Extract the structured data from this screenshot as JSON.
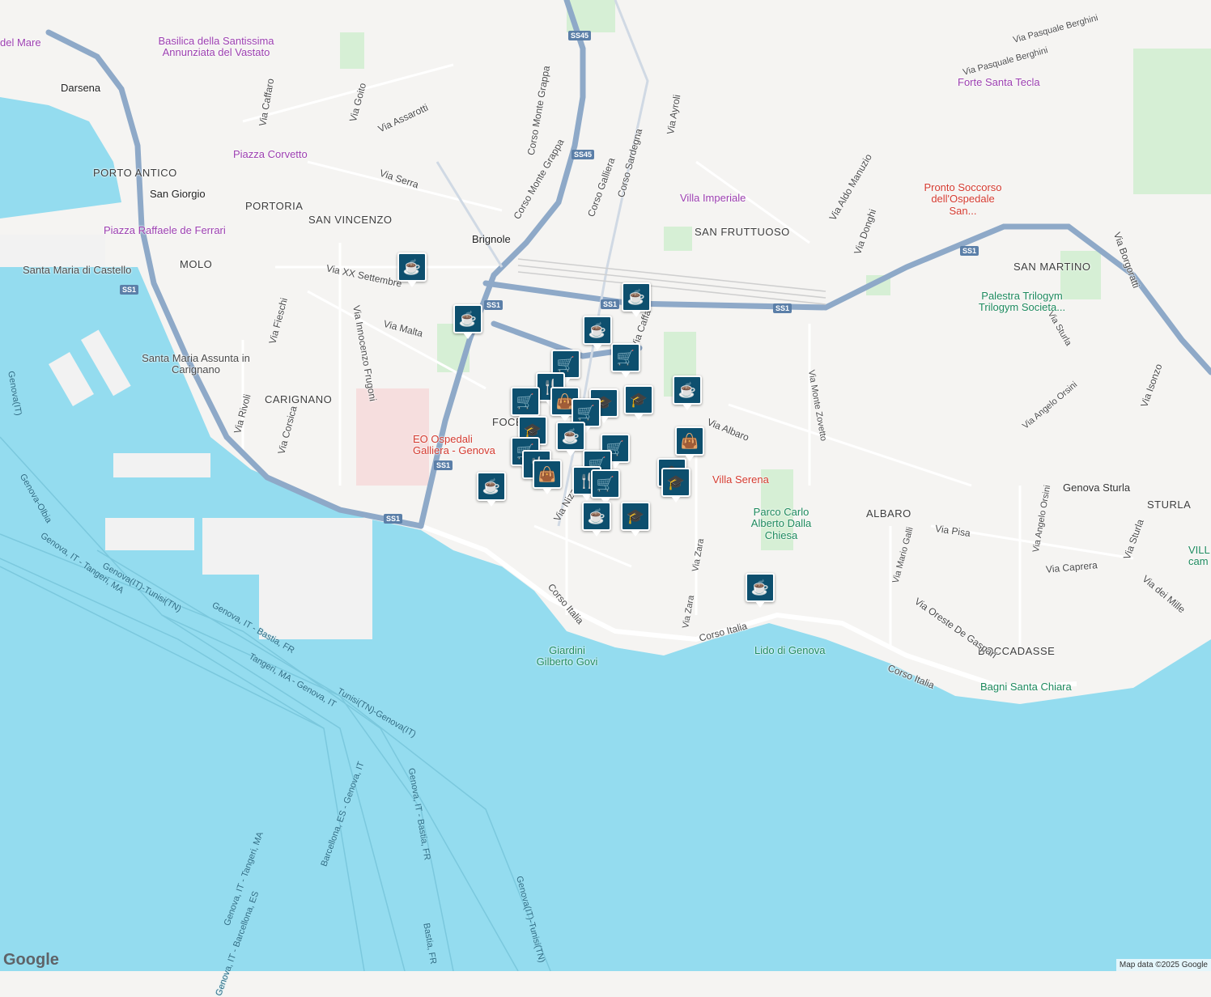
{
  "map": {
    "colors": {
      "sea": "#94dcef",
      "land": "#f5f4f2",
      "road": "#ffffff",
      "highway": "#8ea9c8",
      "park": "#d6efd5",
      "pin": "#0d4f6e"
    },
    "districts": [
      "PORTO ANTICO",
      "PORTORIA",
      "SAN VINCENZO",
      "MOLO",
      "CARIGNANO",
      "SAN FRUTTUOSO",
      "SAN MARTINO",
      "ALBARO",
      "STURLA",
      "BOCCADASSE",
      "FOCE"
    ],
    "streets": [
      "Via Caffaro",
      "Via Goito",
      "Via Assarotti",
      "Corso Monte Grappa",
      "Corso Monte Grappa",
      "Via Serra",
      "Via XX Settembre",
      "Via Malta",
      "Via Fieschi",
      "Via Innocenzo Frugoni",
      "Via Rivoli",
      "Via Corsica",
      "Via Ayroli",
      "Corso Sardegna",
      "Corso Galliera",
      "Via Aldo Manuzio",
      "Via Donghi",
      "Via Pasquale Berghini",
      "Via Pasquale Berghini",
      "Via Borgoratti",
      "Via Sturla",
      "Via Isonzo",
      "Via Angelo Orsini",
      "Via Angelo Orsini",
      "Via Monte Zovetto",
      "Via Albaro",
      "Via Zara",
      "Via Zara",
      "Via Pisa",
      "Via Caprera",
      "Via dei Mille",
      "Via Mario Galli",
      "Via Oreste De Gaspari",
      "Corso Italia",
      "Corso Italia",
      "Corso Italia",
      "Via Nizza",
      "Via Caffa",
      "Via Sturla"
    ],
    "pois": {
      "purple": [
        "Basilica della Santissima Annunziata del Vastato",
        "Piazza Corvetto",
        "Piazza Raffaele de Ferrari",
        "Villa Imperiale",
        "Forte Santa Tecla",
        "del Mare"
      ],
      "red": [
        "Darsena",
        "San Giorgio",
        "Brignole",
        "EO Ospedali Galliera - Genova",
        "Villa Serena",
        "Pronto Soccorso dell'Ospedale San..."
      ],
      "green": [
        "Palestra Trilogym Trilogym Societa...",
        "Lido di Genova",
        "Bagni Santa Chiara",
        "Genova Sturla",
        "VILL cam"
      ],
      "gray": [
        "Santa Maria di Castello",
        "Santa Maria Assunta in Carignano",
        "Parco Carlo Alberto Dalla Chiesa",
        "Giardini Gilberto Govi"
      ]
    },
    "ferry_routes": [
      "Genova-Olbia",
      "Genova, IT - Tangeri, MA",
      "Genova(IT)-Tunisi(TN)",
      "Genova, IT - Bastia, FR",
      "Tangeri, MA - Genova, IT",
      "Tunisi(TN)-Genova(IT)",
      "Genova, IT - Bastia, FR",
      "Barcellona, ES - Genova, IT",
      "Genova, IT - Tangeri, MA",
      "Genova, IT - Barcellona, ES",
      "Bastia, FR",
      "Genova(IT)-Tunisi(TN)",
      "Genova(IT)"
    ],
    "route_shields": [
      "SS45",
      "SS45",
      "SS1",
      "SS1",
      "SS1",
      "SS1",
      "SS1",
      "SS1",
      "SS1"
    ],
    "pins": [
      "cafe-icon",
      "shopping-cart-icon",
      "restaurant-icon",
      "shopping-bag-icon",
      "school-icon"
    ],
    "attribution": "Map data ©2025 Google",
    "logo": "Google"
  }
}
